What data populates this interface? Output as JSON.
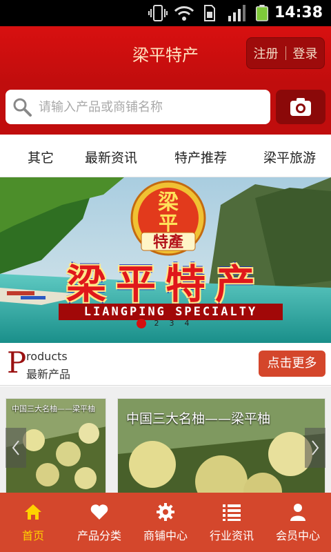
{
  "status_bar": {
    "time": "14:38"
  },
  "header": {
    "title": "梁平特产",
    "register": "注册",
    "login": "登录"
  },
  "search": {
    "placeholder": "请输入产品或商铺名称"
  },
  "nav_tabs": [
    "其它",
    "最新资讯",
    "特产推荐",
    "梁平旅游"
  ],
  "banner": {
    "logo_text": "梁平特產",
    "title": "梁平特产",
    "subtitle": "LIANGPING SPECIALTY",
    "dots": [
      "",
      "2",
      "3",
      "4"
    ]
  },
  "products_section": {
    "letter": "P",
    "english": "roducts",
    "chinese": "最新产品",
    "more": "点击更多",
    "items": [
      {
        "title": "中国三大名柚——梁平柚"
      },
      {
        "title": "中国三大名柚——梁平柚"
      }
    ]
  },
  "bottom_nav": [
    {
      "label": "首页",
      "icon": "home-icon",
      "active": true
    },
    {
      "label": "产品分类",
      "icon": "heart-icon"
    },
    {
      "label": "商铺中心",
      "icon": "gear-icon"
    },
    {
      "label": "行业资讯",
      "icon": "list-icon"
    },
    {
      "label": "会员中心",
      "icon": "user-icon"
    }
  ],
  "colors": {
    "primary_red": "#c20d0d",
    "accent_orange": "#d4472c",
    "active_yellow": "#ffd200"
  }
}
